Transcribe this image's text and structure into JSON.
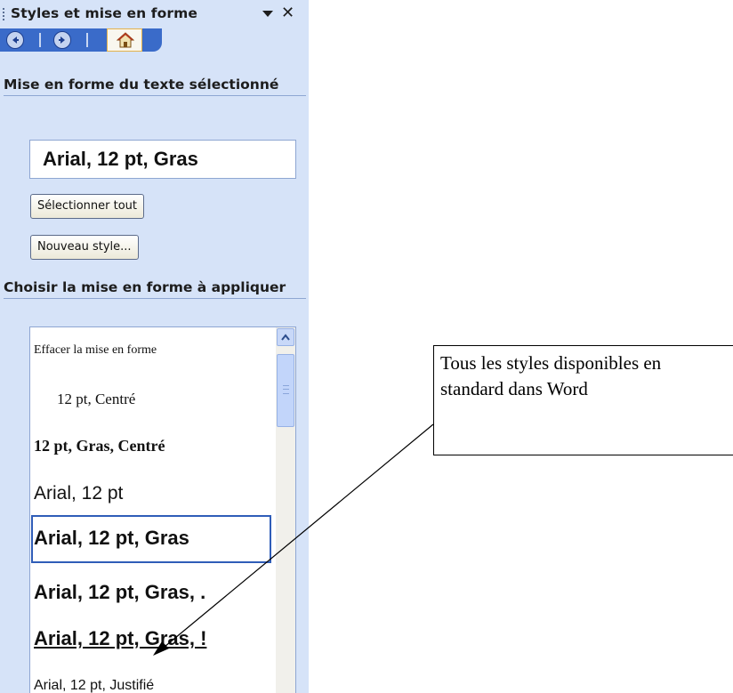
{
  "task_pane": {
    "title": "Styles et mise en forme",
    "section_selected_text": "Mise en forme du texte sélectionné",
    "current_format": "Arial, 12 pt, Gras",
    "select_all_button": "Sélectionner tout",
    "new_style_button": "Nouveau style...",
    "section_choose": "Choisir la mise en forme à appliquer",
    "styles": [
      "Effacer la mise en forme",
      "12 pt, Centré",
      "12 pt, Gras, Centré",
      "Arial, 12 pt",
      "Arial, 12 pt, Gras",
      "Arial, 12 pt, Gras, .",
      "Arial, 12 pt, Gras, !",
      "Arial, 12 pt, Justifié"
    ],
    "selected_style_index": 4
  },
  "callout": {
    "text": "Tous les styles disponibles en standard dans Word"
  },
  "icons": {
    "back": "back-arrow-icon",
    "forward": "forward-arrow-icon",
    "home": "home-icon",
    "menu": "dropdown-arrow-icon",
    "close": "close-icon"
  },
  "colors": {
    "pane_background": "#D6E3F8",
    "nav_strip": "#3A6BC9",
    "selection_border": "#2F5DB8"
  }
}
